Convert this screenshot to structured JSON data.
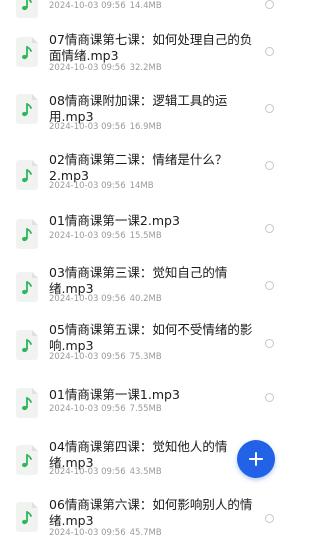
{
  "files": [
    {
      "title": "",
      "date": "2024-10-03 09:56",
      "size": "14.4MB"
    },
    {
      "title": "07情商课第七课：如何处理自己的负面情绪.mp3",
      "date": "2024-10-03 09:56",
      "size": "32.2MB"
    },
    {
      "title": "08情商课附加课：逻辑工具的运用.mp3",
      "date": "2024-10-03 09:56",
      "size": "16.9MB"
    },
    {
      "title": "02情商课第二课：情绪是什么？2.mp3",
      "date": "2024-10-03 09:56",
      "size": "14MB"
    },
    {
      "title": "01情商课第一课2.mp3",
      "date": "2024-10-03 09:56",
      "size": "15.5MB"
    },
    {
      "title": "03情商课第三课：觉知自己的情绪.mp3",
      "date": "2024-10-03 09:56",
      "size": "40.2MB"
    },
    {
      "title": "05情商课第五课：如何不受情绪的影响.mp3",
      "date": "2024-10-03 09:56",
      "size": "75.3MB"
    },
    {
      "title": "01情商课第一课1.mp3",
      "date": "2024-10-03 09:56",
      "size": "7.55MB"
    },
    {
      "title": "04情商课第四课：觉知他人的情绪.mp3",
      "date": "2024-10-03 09:56",
      "size": "43.5MB"
    },
    {
      "title": "06情商课第六课：如何影响别人的情绪.mp3",
      "date": "2024-10-03 09:56",
      "size": "45.7MB"
    }
  ],
  "icons": {
    "file": "music-file-icon",
    "select": "radio-circle-icon",
    "fab": "plus-icon"
  },
  "colors": {
    "accent": "#2262e6",
    "music_note": "#2eb75c"
  }
}
